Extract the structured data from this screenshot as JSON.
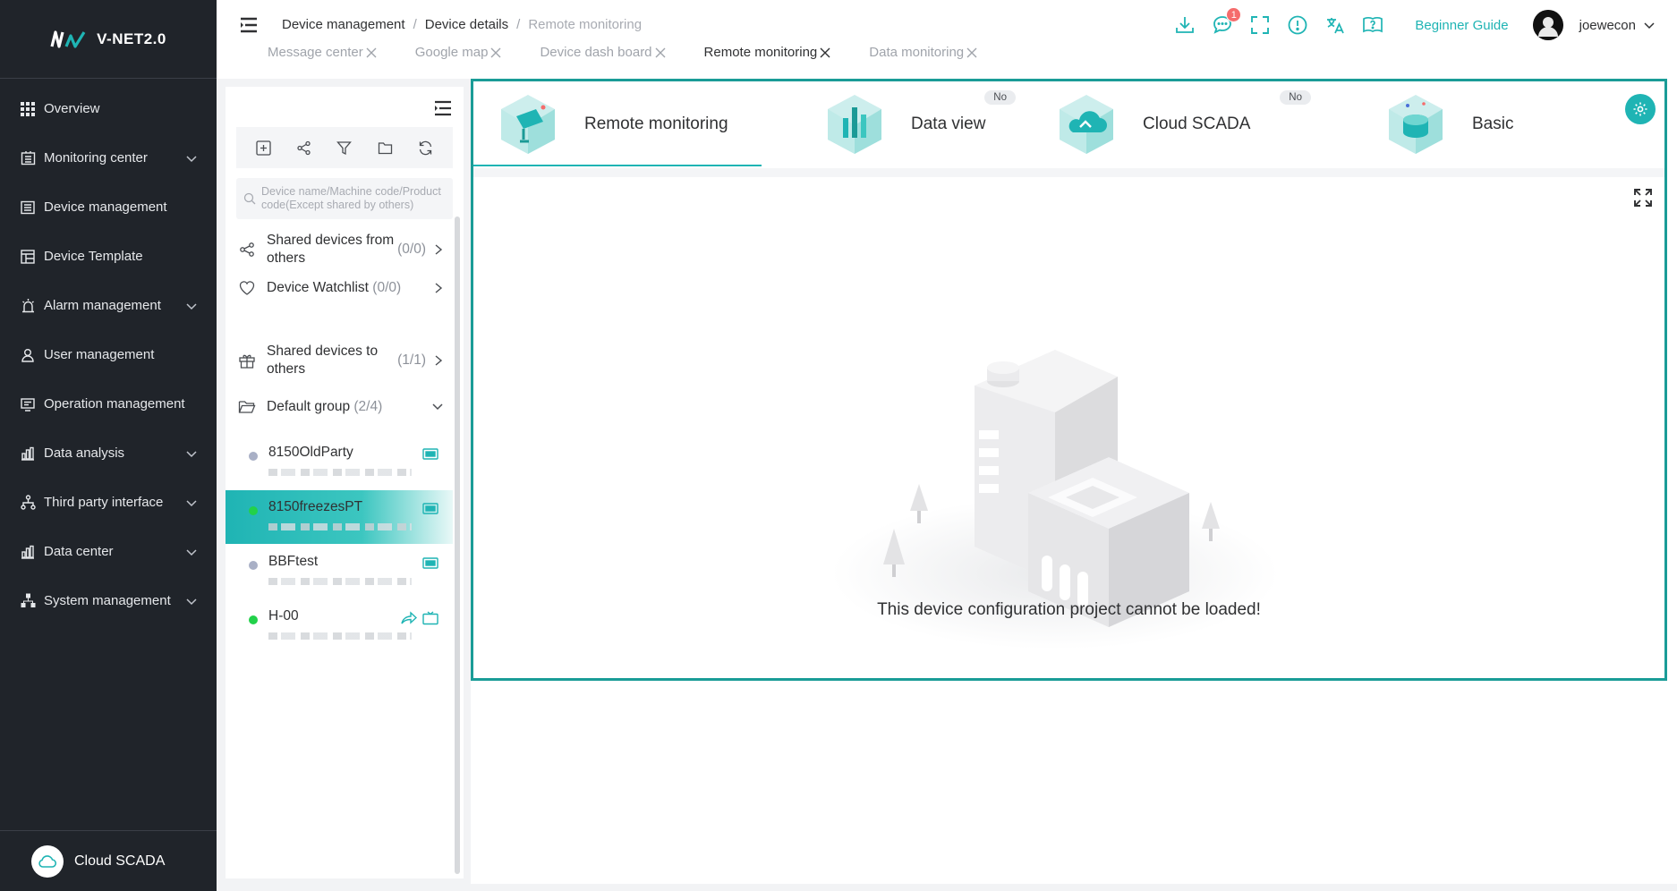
{
  "app": {
    "logo_text": "V-NET2.0"
  },
  "sidebar": {
    "items": [
      {
        "label": "Overview",
        "icon": "grid-icon",
        "expandable": false
      },
      {
        "label": "Monitoring center",
        "icon": "monitor-building-icon",
        "expandable": true
      },
      {
        "label": "Device management",
        "icon": "device-list-icon",
        "expandable": false
      },
      {
        "label": "Device Template",
        "icon": "template-icon",
        "expandable": false
      },
      {
        "label": "Alarm management",
        "icon": "alarm-icon",
        "expandable": true
      },
      {
        "label": "User management",
        "icon": "user-icon",
        "expandable": false
      },
      {
        "label": "Operation management",
        "icon": "operation-icon",
        "expandable": false
      },
      {
        "label": "Data analysis",
        "icon": "bar-chart-icon",
        "expandable": true
      },
      {
        "label": "Third party interface",
        "icon": "network-icon",
        "expandable": true
      },
      {
        "label": "Data center",
        "icon": "bar-chart-icon",
        "expandable": true
      },
      {
        "label": "System management",
        "icon": "org-chart-icon",
        "expandable": true
      }
    ],
    "footer_label": "Cloud SCADA"
  },
  "header": {
    "breadcrumb": [
      "Device management",
      "Device details",
      "Remote monitoring"
    ],
    "tabs": [
      {
        "label": "Message center",
        "active": false
      },
      {
        "label": "Google map",
        "active": false
      },
      {
        "label": "Device dash board",
        "active": false
      },
      {
        "label": "Remote monitoring",
        "active": true
      },
      {
        "label": "Data monitoring",
        "active": false
      }
    ],
    "message_badge": "1",
    "guide_label": "Beginner Guide",
    "username": "joewecon"
  },
  "device_panel": {
    "search_placeholder": "Device name/Machine code/Product code(Except shared by others)",
    "groups": {
      "shared_from_label": "Shared devices from others",
      "shared_from_count": "(0/0)",
      "watchlist_label": "Device Watchlist",
      "watchlist_count": "(0/0)",
      "shared_to_label": "Shared devices to others",
      "shared_to_count": "(1/1)",
      "default_label": "Default group",
      "default_count": "(2/4)"
    },
    "devices": [
      {
        "name": "8150OldParty",
        "status": "offline",
        "status_color": "#a9b0c6"
      },
      {
        "name": "8150freezesPT",
        "status": "online",
        "status_color": "#22d14a"
      },
      {
        "name": "BBFtest",
        "status": "offline",
        "status_color": "#a9b0c6"
      },
      {
        "name": "H-00",
        "status": "online",
        "status_color": "#22d14a"
      }
    ]
  },
  "main": {
    "tabs": [
      {
        "label": "Remote monitoring",
        "active": true,
        "tag": ""
      },
      {
        "label": "Data view",
        "active": false,
        "tag": "No"
      },
      {
        "label": "Cloud SCADA",
        "active": false,
        "tag": "No"
      },
      {
        "label": "Basic",
        "active": false,
        "tag": ""
      }
    ],
    "empty_message": "This device configuration project cannot be loaded!"
  },
  "colors": {
    "accent": "#1fb4b4",
    "sidebar_bg": "#20242a",
    "frame_border": "#1a9c97"
  }
}
